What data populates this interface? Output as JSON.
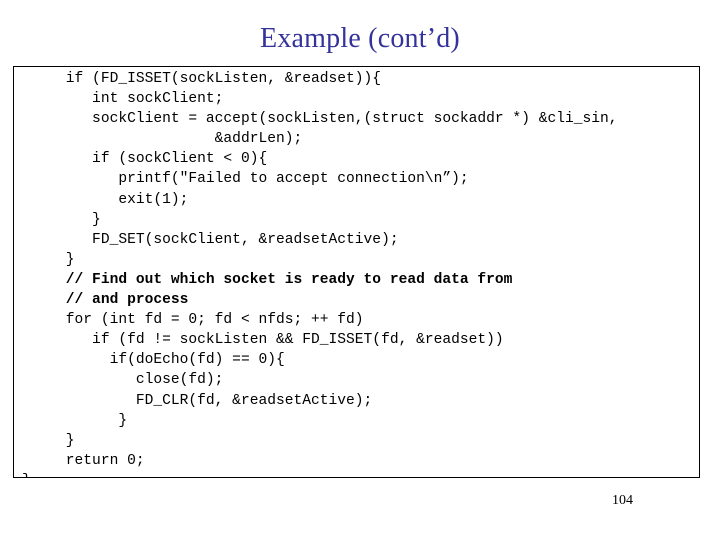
{
  "slide": {
    "title": "Example (cont’d)",
    "title_color": "#333399",
    "background_color": "#ffffff",
    "page_number": "104"
  },
  "code_block": {
    "border_color": "#000000",
    "text_color": "#000000",
    "lines": [
      {
        "text": "     if (FD_ISSET(sockListen, &readset)){",
        "bold": false
      },
      {
        "text": "        int sockClient;",
        "bold": false
      },
      {
        "text": "        sockClient = accept(sockListen,(struct sockaddr *) &cli_sin,",
        "bold": false
      },
      {
        "text": "                      &addrLen);",
        "bold": false
      },
      {
        "text": "        if (sockClient < 0){",
        "bold": false
      },
      {
        "text": "           printf(\"Failed to accept connection\\n”);",
        "bold": false
      },
      {
        "text": "           exit(1);",
        "bold": false
      },
      {
        "text": "        }",
        "bold": false
      },
      {
        "text": "        FD_SET(sockClient, &readsetActive);",
        "bold": false
      },
      {
        "text": "     }",
        "bold": false
      },
      {
        "text": "     // Find out which socket is ready to read data from",
        "bold": true
      },
      {
        "text": "     // and process",
        "bold": true
      },
      {
        "text": "     for (int fd = 0; fd < nfds; ++ fd)",
        "bold": false
      },
      {
        "text": "        if (fd != sockListen && FD_ISSET(fd, &readset))",
        "bold": false
      },
      {
        "text": "          if(doEcho(fd) == 0){",
        "bold": false
      },
      {
        "text": "             close(fd);",
        "bold": false
      },
      {
        "text": "             FD_CLR(fd, &readsetActive);",
        "bold": false
      },
      {
        "text": "           }",
        "bold": false
      },
      {
        "text": "     }",
        "bold": false
      },
      {
        "text": "     return 0;",
        "bold": false
      },
      {
        "text": "}",
        "bold": false
      }
    ]
  }
}
